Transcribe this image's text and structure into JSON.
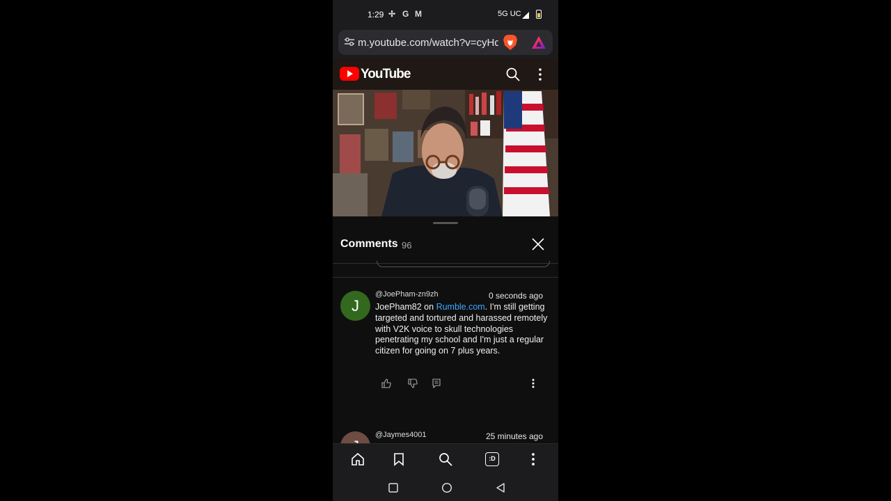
{
  "status_bar": {
    "time": "1:29",
    "notification_icons": [
      "pinwheel-icon",
      "google-icon",
      "gmail-icon"
    ],
    "network": "5G UC",
    "signal_icon": "signal-icon",
    "battery_icon": "battery-icon"
  },
  "browser": {
    "url": "m.youtube.com/watch?v=cyHq",
    "site_settings_icon": "tune-icon",
    "brave_icon": "brave-lion-icon",
    "rewards_icon": "brave-rewards-icon"
  },
  "youtube_header": {
    "wordmark": "YouTube",
    "search_icon": "search-icon",
    "menu_icon": "more-vert-icon"
  },
  "comments_panel": {
    "title": "Comments",
    "count": "96",
    "comments": [
      {
        "avatar_letter": "J",
        "avatar_color": "#33691e",
        "author": "@JoePham-zn9zh",
        "time": "0 seconds ago",
        "text_before_link": "JoePham82 on ",
        "link_text": "Rumble.com",
        "text_after_link": ". I'm still getting targeted and tortured and harassed remotely with V2K voice to skull technologies penetrating my school and I'm just a regular citizen for going on 7 plus years."
      },
      {
        "avatar_letter": "J",
        "avatar_color": "#6d4c41",
        "author": "@Jaymes4001",
        "time": "25 minutes ago"
      }
    ]
  },
  "browser_toolbar": {
    "buttons": [
      "home-icon",
      "bookmark-icon",
      "search-icon",
      "tab-switcher-icon",
      "more-vert-icon"
    ],
    "tab_switcher_label": ":D"
  },
  "android_nav": [
    "recents-icon",
    "home-circle-icon",
    "back-icon"
  ]
}
